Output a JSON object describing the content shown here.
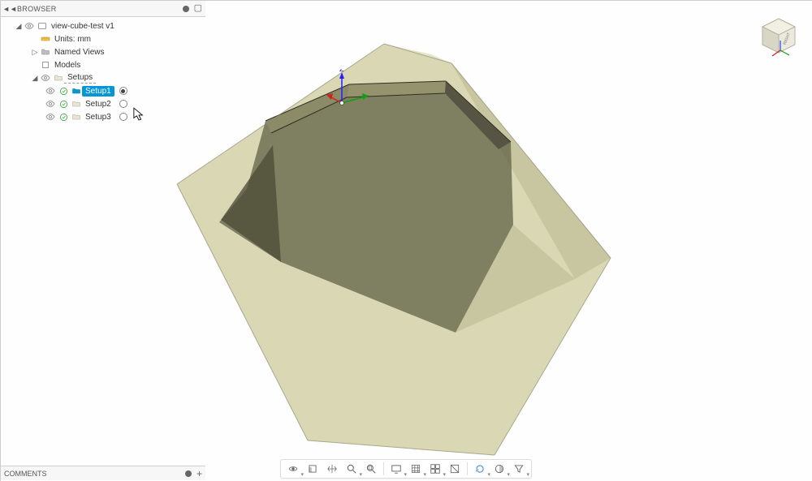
{
  "browser": {
    "title": "BROWSER",
    "root": {
      "label": "view-cube-test v1",
      "units": {
        "label": "Units: mm"
      },
      "namedViews": {
        "label": "Named Views"
      },
      "models": {
        "label": "Models"
      },
      "setups": {
        "label": "Setups",
        "items": [
          {
            "label": "Setup1",
            "active": true
          },
          {
            "label": "Setup2",
            "active": false
          },
          {
            "label": "Setup3",
            "active": false
          }
        ]
      }
    }
  },
  "comments": {
    "title": "COMMENTS"
  },
  "viewcube": {
    "face": "RIGHT"
  },
  "viewport": {
    "axes": {
      "z": "Z"
    }
  },
  "toolbar": {
    "items": [
      {
        "name": "orbit"
      },
      {
        "name": "look-at"
      },
      {
        "name": "pan"
      },
      {
        "name": "zoom"
      },
      {
        "name": "fit"
      },
      {
        "name": "display-settings"
      },
      {
        "name": "grid-snaps"
      },
      {
        "name": "viewports"
      },
      {
        "name": "section-analysis"
      },
      {
        "name": "reset"
      },
      {
        "name": "render-as"
      },
      {
        "name": "filter"
      }
    ]
  }
}
